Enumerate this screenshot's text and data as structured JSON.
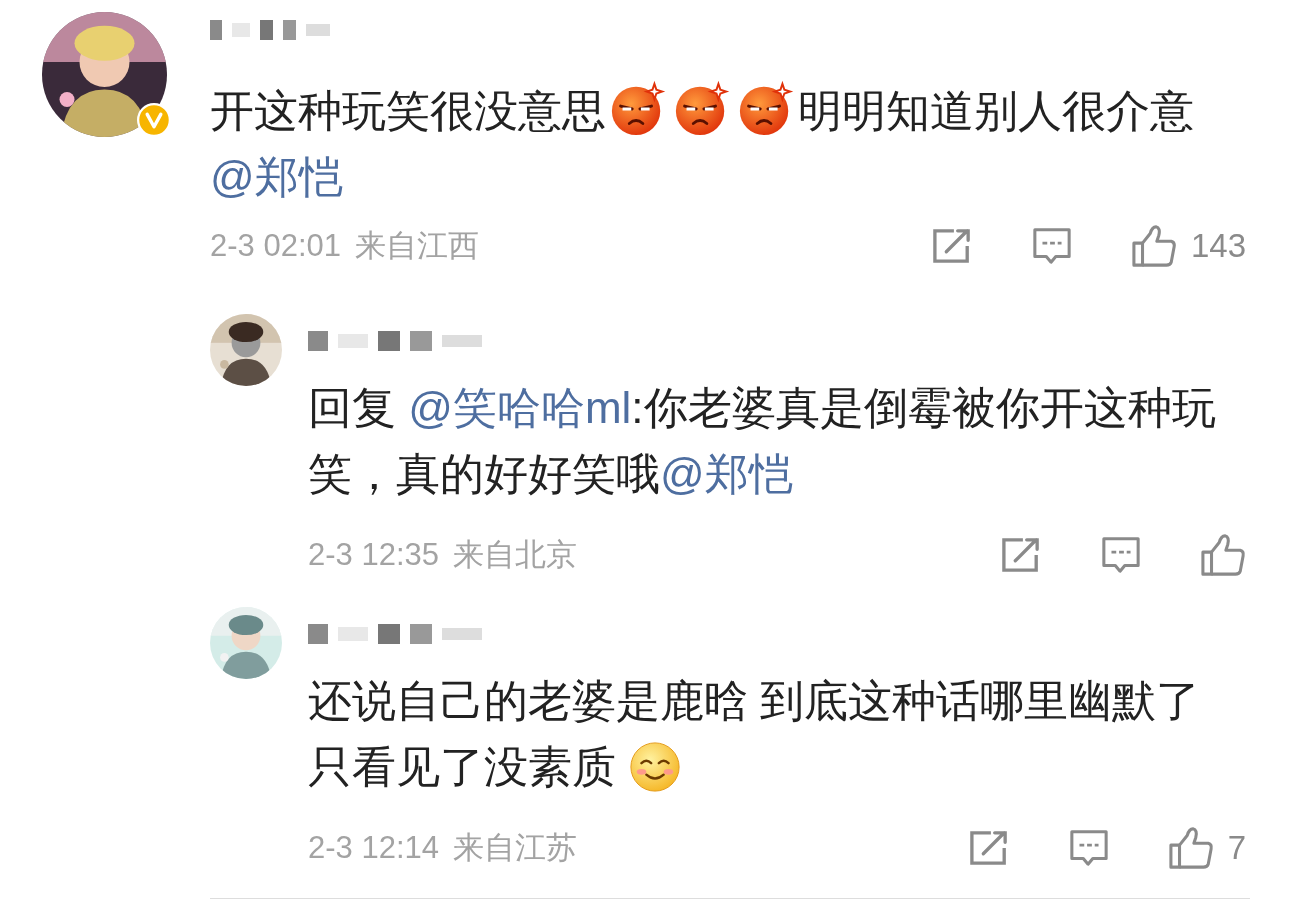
{
  "comments": [
    {
      "verified": true,
      "like_count": "143",
      "date": "2-3 02:01",
      "location": "来自江西",
      "segments": [
        {
          "kind": "text",
          "text": "开这种玩笑很没意思"
        },
        {
          "kind": "angry"
        },
        {
          "kind": "angry"
        },
        {
          "kind": "angry"
        },
        {
          "kind": "text",
          "text": "明明知道别人很介意"
        },
        {
          "kind": "mention",
          "text": "@郑恺"
        }
      ],
      "replies": [
        {
          "date": "2-3 12:35",
          "location": "来自北京",
          "segments": [
            {
              "kind": "text",
              "text": "回复 "
            },
            {
              "kind": "mention",
              "text": "@笑哈哈ml"
            },
            {
              "kind": "text",
              "text": ":你老婆真是倒霉被你开这种玩笑，真的好好笑哦"
            },
            {
              "kind": "mention",
              "text": "@郑恺"
            }
          ]
        },
        {
          "date": "2-3 12:14",
          "location": "来自江苏",
          "like_count": "7",
          "segments": [
            {
              "kind": "text",
              "text": "还说自己的老婆是鹿晗 到底这种话哪里幽默了只看见了没素质 "
            },
            {
              "kind": "smile"
            }
          ]
        }
      ]
    }
  ]
}
